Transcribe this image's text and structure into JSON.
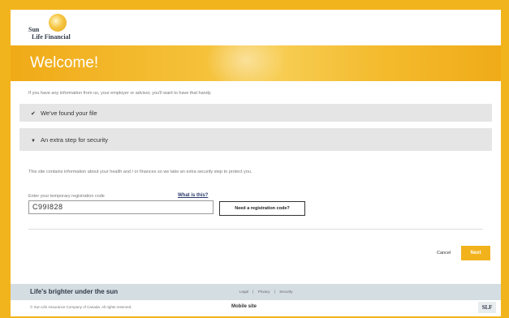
{
  "brand": {
    "name_line1": "Sun",
    "name_line2": "Life Financial"
  },
  "banner": {
    "title": "Welcome!"
  },
  "intro_text": "If you have any information from us, your employer or advisor, you'll want to have that handy.",
  "sections": [
    {
      "label": "We've found your file",
      "icon": "check-icon"
    },
    {
      "label": "An extra step for security",
      "icon": "triangle-down-icon"
    }
  ],
  "security_info": "This site contains information about your health and / or finances so we take an extra security step to protect you.",
  "registration": {
    "label": "Enter your temporary registration code",
    "what_link": "What is this?",
    "value": "C99I828",
    "need_button": "Need a registration code?"
  },
  "actions": {
    "cancel": "Cancel",
    "next": "Next"
  },
  "footer": {
    "tagline": "Life's brighter under the sun",
    "links": [
      "Legal",
      "|",
      "Privacy",
      "|",
      "Security"
    ],
    "copyright": "© Sun Life Assurance Company of Canada. All rights reserved.",
    "mobile": "Mobile site",
    "badge": "SLF"
  },
  "colors": {
    "accent": "#f2b21c",
    "footer_bg": "#d4dde2",
    "section_bg": "#e5e5e5"
  }
}
